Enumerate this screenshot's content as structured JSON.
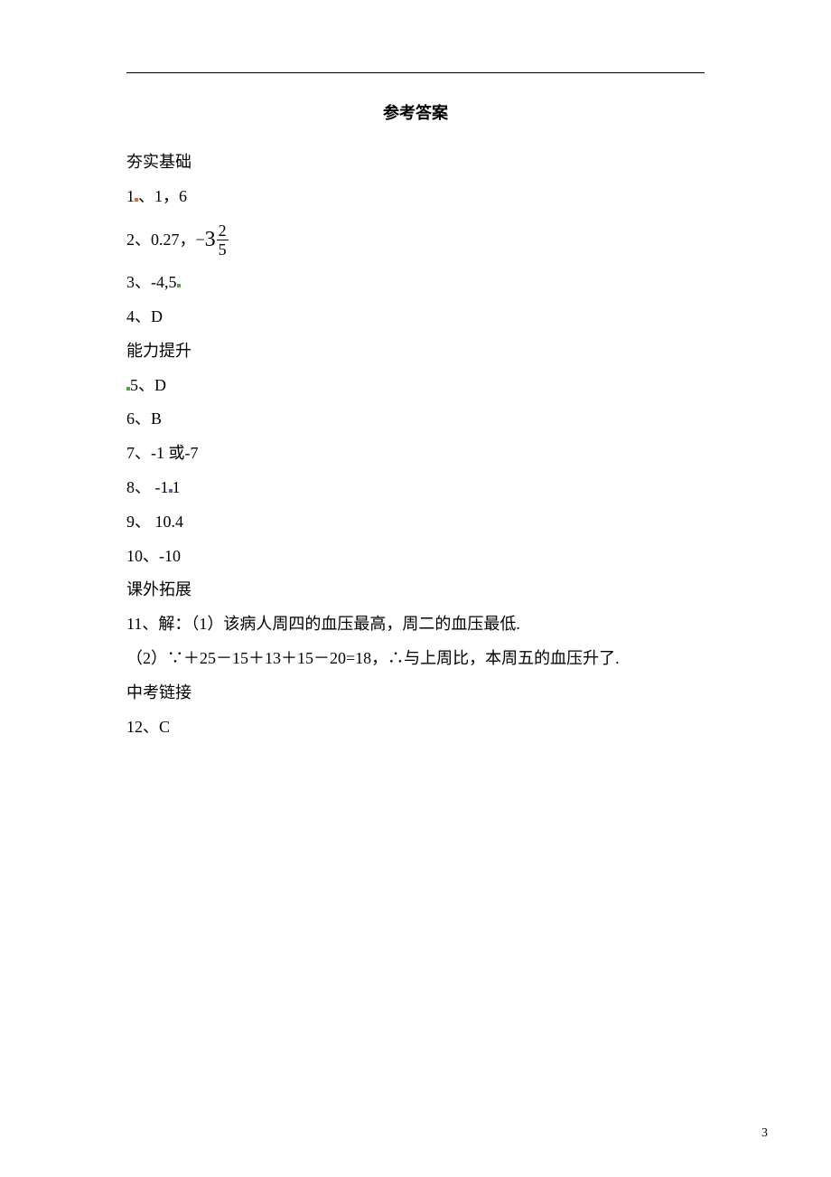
{
  "title": "参考答案",
  "sections": {
    "s1": {
      "heading": "夯实基础"
    },
    "s2": {
      "heading": "能力提升"
    },
    "s3": {
      "heading": "课外拓展"
    },
    "s4": {
      "heading": "中考链接"
    }
  },
  "answers": {
    "a1": "、1，6",
    "a2_prefix": "2、0.27，",
    "a2_sign": "−",
    "a2_whole": "3",
    "a2_num": "2",
    "a2_den": "5",
    "a3": "3、-4,5",
    "a4": "4、D",
    "a5": "5、D",
    "a6": "6、B",
    "a7": "7、-1 或-7",
    "a8a": "8、 -1",
    "a8b": "1",
    "a9": "9、 10.4",
    "a10": "10、-10",
    "a11_l1": "11、解：（1）该病人周四的血压最高，周二的血压最低.",
    "a11_l2": "（2）∵＋25－15＋13＋15－20=18，∴与上周比，本周五的血压升了.",
    "a12": "12、C"
  },
  "pageNumber": "3"
}
